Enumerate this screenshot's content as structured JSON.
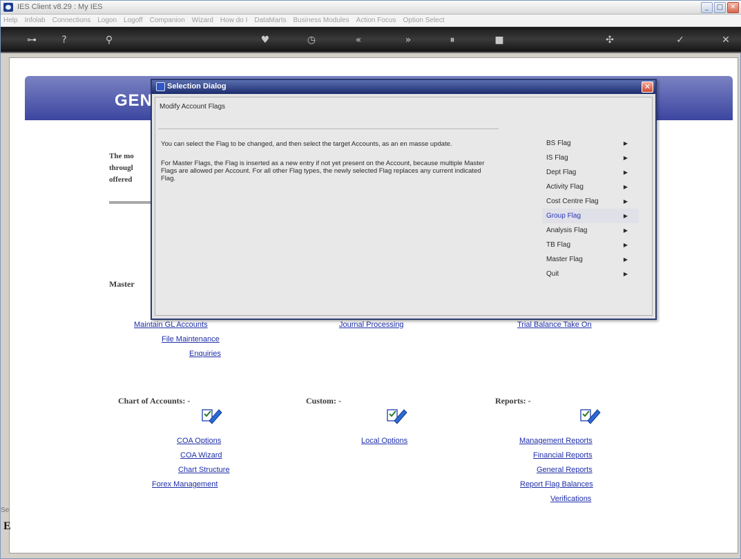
{
  "window": {
    "title": "IES Client v8.29 : My IES"
  },
  "menu": [
    "Help",
    "Infolab",
    "Connections",
    "Logon",
    "Logoff",
    "Companion",
    "Wizard",
    "How do I",
    "DataMarts",
    "Business Modules",
    "Action Focus",
    "Option Select"
  ],
  "banner": {
    "heading": "GEN"
  },
  "intro": {
    "line1": "The mo",
    "line2": "througl",
    "line3": "offered"
  },
  "sections": {
    "master": "Master",
    "chart": "Chart of Accounts: -",
    "custom": "Custom: -",
    "reports": "Reports: -"
  },
  "links": {
    "maintain_gl": "Maintain GL Accounts",
    "file_maintenance": "File Maintenance",
    "enquiries": "Enquiries",
    "journal_processing": "Journal Processing",
    "trial_balance": "Trial Balance Take On",
    "coa_options": "COA Options",
    "coa_wizard": "COA Wizard",
    "chart_structure": "Chart Structure",
    "forex_management": "Forex Management",
    "local_options": "Local Options",
    "management_reports": "Management Reports",
    "financial_reports": "Financial Reports",
    "general_reports": "General Reports",
    "report_flag_balances": "Report Flag Balances",
    "verifications": "Verifications"
  },
  "dialog": {
    "title": "Selection Dialog",
    "subtitle": "Modify Account Flags",
    "para1": "You can select the Flag to be changed, and then select the target Accounts, as an en masse update.",
    "para2": "For Master Flags, the Flag is inserted as a new entry if not yet present on the Account, because multiple Master Flags are allowed per Account. For all other Flag types, the newly selected Flag replaces any current indicated Flag.",
    "flags": [
      "BS Flag",
      "IS Flag",
      "Dept Flag",
      "Activity Flag",
      "Cost Centre Flag",
      "Group Flag",
      "Analysis Flag",
      "TB Flag",
      "Master Flag",
      "Quit"
    ],
    "selected": "Group Flag"
  },
  "status": {
    "left": "Se",
    "left2": "E"
  },
  "colors": {
    "link": "#1e2ea8",
    "banner": "#3c46a0",
    "dialog_title": "#1c2c6c"
  }
}
